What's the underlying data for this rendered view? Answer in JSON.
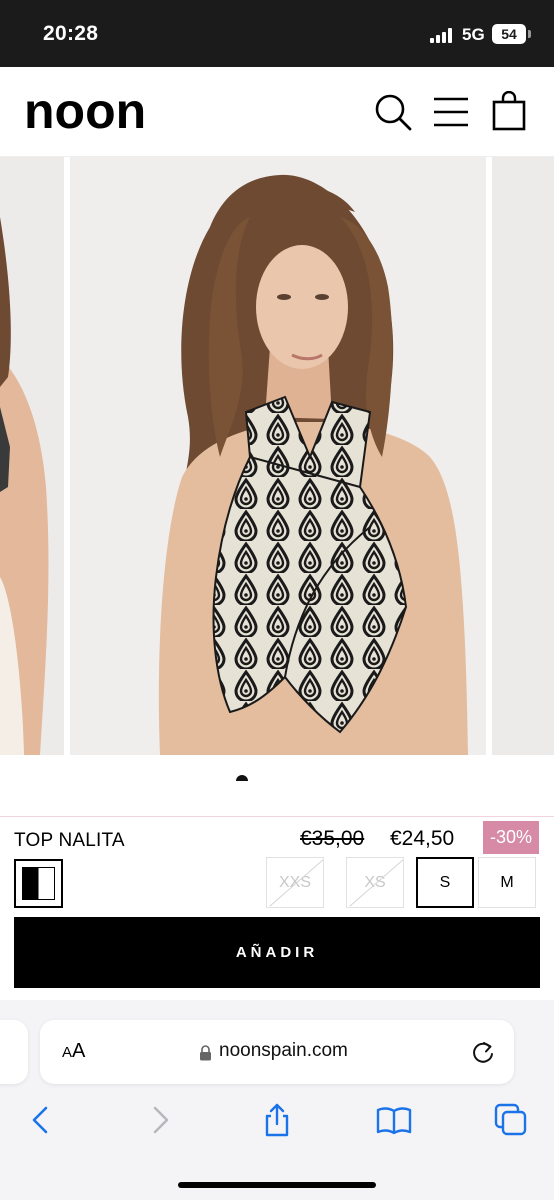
{
  "status_bar": {
    "time": "20:28",
    "network": "5G",
    "battery": "54"
  },
  "site": {
    "logo": "noon"
  },
  "header_icons": [
    "search-icon",
    "menu-icon",
    "shopping-bag-icon"
  ],
  "gallery": {
    "slide_count_visible": 3,
    "zoom_icon": "zoom-icon"
  },
  "product": {
    "name": "TOP NALITA",
    "old_price": "€35,00",
    "price": "€24,50",
    "discount": "-30%",
    "colors": {
      "swatch": [
        "#000000",
        "#ffffff"
      ],
      "discount_bg": "#d68aa6"
    },
    "sizes": [
      {
        "label": "XXS",
        "available": false,
        "selected": false
      },
      {
        "label": "XS",
        "available": false,
        "selected": false
      },
      {
        "label": "S",
        "available": true,
        "selected": true
      },
      {
        "label": "M",
        "available": true,
        "selected": false
      }
    ],
    "add_label": "AÑADIR"
  },
  "browser": {
    "text_size_label_small": "A",
    "text_size_label_large": "A",
    "url": "noonspain.com",
    "accent": "#1a73e8",
    "toolbar_icons": [
      "back-icon",
      "forward-icon",
      "share-icon",
      "bookmarks-icon",
      "tabs-icon"
    ]
  }
}
